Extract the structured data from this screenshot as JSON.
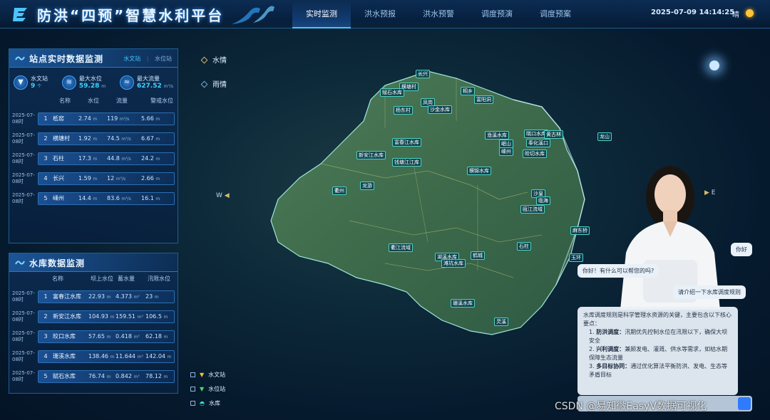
{
  "app": {
    "title": "防洪“四预”智慧水利平台"
  },
  "nav": {
    "tabs": [
      "实时监测",
      "洪水预报",
      "洪水预警",
      "调度预演",
      "调度预案"
    ]
  },
  "header": {
    "datetime": "2025-07-09 14:14:25",
    "weather": "晴"
  },
  "station_panel": {
    "title": "站点实时数据监测",
    "tabs": [
      "水文站",
      "水位站"
    ],
    "stats": [
      {
        "icon": "water-station-icon",
        "label": "水文站",
        "value": "9",
        "unit": "个"
      },
      {
        "icon": "water-level-icon",
        "label": "最大水位",
        "value": "59.28",
        "unit": "m"
      },
      {
        "icon": "flow-icon",
        "label": "最大流量",
        "value": "627.52",
        "unit": "m³/s"
      }
    ],
    "columns": [
      "名称",
      "水位",
      "流量",
      "警戒水位"
    ],
    "rows": [
      {
        "date": [
          "2025-07-",
          "08时"
        ],
        "rank": "1",
        "name": "柢窑",
        "level": "2.74",
        "level_unit": "m",
        "flow": "119",
        "flow_unit": "m³/s",
        "warn": "5.66",
        "warn_unit": "m"
      },
      {
        "date": [
          "2025-07-",
          "08时"
        ],
        "rank": "2",
        "name": "横塘村",
        "level": "1.92",
        "level_unit": "m",
        "flow": "74.5",
        "flow_unit": "m³/s",
        "warn": "6.67",
        "warn_unit": "m"
      },
      {
        "date": [
          "2025-07-",
          "08时"
        ],
        "rank": "3",
        "name": "石柱",
        "level": "17.3",
        "level_unit": "m",
        "flow": "44.8",
        "flow_unit": "m³/s",
        "warn": "24.2",
        "warn_unit": "m"
      },
      {
        "date": [
          "2025-07-",
          "08时"
        ],
        "rank": "4",
        "name": "长兴",
        "level": "1.59",
        "level_unit": "m",
        "flow": "12",
        "flow_unit": "m³/s",
        "warn": "2.66",
        "warn_unit": "m"
      },
      {
        "date": [
          "2025-07-",
          "08时"
        ],
        "rank": "5",
        "name": "嵊州",
        "level": "14.4",
        "level_unit": "m",
        "flow": "83.6",
        "flow_unit": "m³/s",
        "warn": "16.1",
        "warn_unit": "m"
      }
    ]
  },
  "reservoir_panel": {
    "title": "水库数据监测",
    "columns": [
      "名称",
      "坝上水位",
      "蓄水量",
      "汛限水位"
    ],
    "rows": [
      {
        "date": [
          "2025-07-",
          "08时"
        ],
        "rank": "1",
        "name": "富春江水库",
        "level": "22.93",
        "level_unit": "m",
        "storage": "4.373",
        "storage_unit": "m³",
        "limit": "23",
        "limit_unit": "m"
      },
      {
        "date": [
          "2025-07-",
          "08时"
        ],
        "rank": "2",
        "name": "新安江水库",
        "level": "104.93",
        "level_unit": "m",
        "storage": "159.51",
        "storage_unit": "m³",
        "limit": "106.5",
        "limit_unit": "m"
      },
      {
        "date": [
          "2025-07-",
          "08时"
        ],
        "rank": "3",
        "name": "皎口水库",
        "level": "57.65",
        "level_unit": "m",
        "storage": "0.418",
        "storage_unit": "m³",
        "limit": "62.18",
        "limit_unit": "m"
      },
      {
        "date": [
          "2025-07-",
          "08时"
        ],
        "rank": "4",
        "name": "珊溪水库",
        "level": "138.46",
        "level_unit": "m",
        "storage": "11.644",
        "storage_unit": "m³",
        "limit": "142.04",
        "limit_unit": "m"
      },
      {
        "date": [
          "2025-07-",
          "08时"
        ],
        "rank": "5",
        "name": "赋石水库",
        "level": "76.74",
        "level_unit": "m",
        "storage": "0.842",
        "storage_unit": "m³",
        "limit": "78.12",
        "limit_unit": "m"
      }
    ]
  },
  "layers": [
    "水情",
    "雨情"
  ],
  "legend": [
    {
      "label": "水文站",
      "icon": "yellow-triangle-icon",
      "color": "#f2c42c"
    },
    {
      "label": "水位站",
      "icon": "green-triangle-icon",
      "color": "#3ee06a"
    },
    {
      "label": "水库",
      "icon": "reservoir-icon",
      "color": "#3fe0c8"
    }
  ],
  "compass": {
    "west": "W",
    "east": "E"
  },
  "map_pins": [
    "长兴",
    "横塘村",
    "赋石水库",
    "桐乡",
    "杨东村",
    "凤岗",
    "沙金水库",
    "富阳洞",
    "富春江水库",
    "新安江水库",
    "钱塘江江库",
    "渔溪水库",
    "晓口水库",
    "黄古林",
    "岷山",
    "奉化溪口",
    "嵊州",
    "皎切水库",
    "横锦水库",
    "龙游",
    "衢州",
    "湖溪水库",
    "沙皇",
    "临海",
    "瓯江流域",
    "石柱",
    "麻东桥",
    "玉环",
    "滩坑水库",
    "鹤城",
    "珊溪水库",
    "灵溪",
    "龙山",
    "衢江流域"
  ],
  "chat": {
    "greeting_user": "你好",
    "greeting_bot": "你好！有什么可以帮您的吗?",
    "question": "请介绍一下水库调度规则",
    "answer_intro": "水库调度规则是科学管理水资源的关键，主要包含以下核心要点：",
    "points": [
      {
        "num": "1.",
        "title": "防洪调度：",
        "text": "汛期优先控制水位在汛限以下，确保大坝安全"
      },
      {
        "num": "2.",
        "title": "兴利调度：",
        "text": "兼顾发电、灌溉、供水等需求，如枯水期保障生态流量"
      },
      {
        "num": "3.",
        "title": "多目标协同：",
        "text": "通过优化算法平衡防洪、发电、生态等矛盾目标"
      }
    ]
  },
  "watermark": "CSDN @易知微EasyV数据可视化"
}
